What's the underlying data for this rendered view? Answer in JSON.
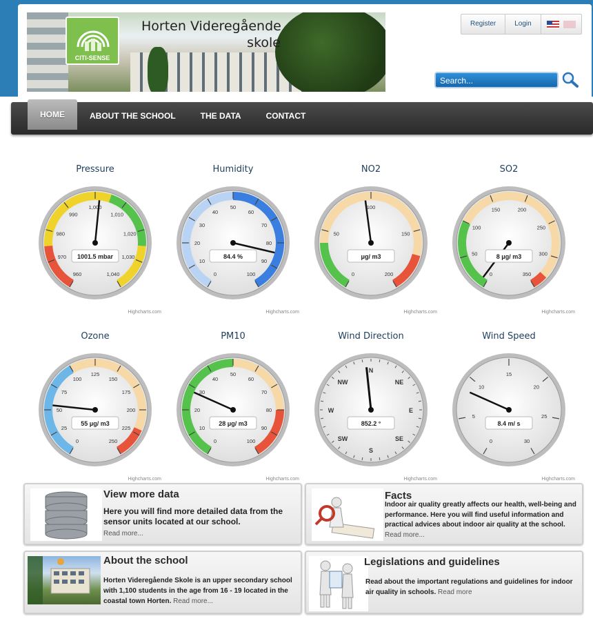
{
  "header": {
    "title_line1": "Horten Videregående",
    "title_line2": "skole",
    "logo_text": "CITI-SENSE",
    "register_label": "Register",
    "login_label": "Login",
    "search_placeholder": "Search...",
    "flags": [
      "flag-us-icon",
      "flag-no-icon"
    ]
  },
  "nav": {
    "items": [
      {
        "label": "HOME",
        "active": true
      },
      {
        "label": "ABOUT THE SCHOOL",
        "active": false
      },
      {
        "label": "THE DATA",
        "active": false
      },
      {
        "label": "CONTACT",
        "active": false
      }
    ]
  },
  "gauges": [
    {
      "title": "Pressure",
      "readout": "1001.5 mbar",
      "value": 1001.5,
      "min": 960,
      "max": 1040,
      "ticks": [
        "960",
        "970",
        "980",
        "990",
        "1,000",
        "1,010",
        "1,020",
        "1,030",
        "1,040"
      ],
      "bands": [
        {
          "from": 960,
          "to": 975,
          "color": "#e8543a"
        },
        {
          "from": 975,
          "to": 990,
          "color": "#f0d32a"
        },
        {
          "from": 990,
          "to": 1005,
          "color": "#f0d32a"
        },
        {
          "from": 1005,
          "to": 1025,
          "color": "#55c24b"
        },
        {
          "from": 1025,
          "to": 1040,
          "color": "#f0d32a"
        }
      ]
    },
    {
      "title": "Humidity",
      "readout": "84.4 %",
      "value": 84.4,
      "min": 0,
      "max": 100,
      "ticks": [
        "0",
        "10",
        "20",
        "30",
        "40",
        "50",
        "60",
        "70",
        "80",
        "90",
        "100"
      ],
      "bands": [
        {
          "from": 0,
          "to": 50,
          "color": "#b9d3f5"
        },
        {
          "from": 50,
          "to": 100,
          "color": "#3a7ee0"
        }
      ]
    },
    {
      "title": "NO2",
      "readout": "μg/ m3",
      "value": 95,
      "min": 0,
      "max": 200,
      "ticks": [
        "0",
        "50",
        "100",
        "150",
        "200"
      ],
      "bands": [
        {
          "from": 0,
          "to": 40,
          "color": "#55c24b"
        },
        {
          "from": 40,
          "to": 170,
          "color": "#f6d9a6"
        },
        {
          "from": 170,
          "to": 200,
          "color": "#e8543a"
        }
      ]
    },
    {
      "title": "SO2",
      "readout": "8 μg/ m3",
      "value": 8,
      "min": 0,
      "max": 350,
      "ticks": [
        "0",
        "50",
        "100",
        "150",
        "200",
        "250",
        "300",
        "350"
      ],
      "bands": [
        {
          "from": 0,
          "to": 100,
          "color": "#55c24b"
        },
        {
          "from": 100,
          "to": 330,
          "color": "#f6d9a6"
        },
        {
          "from": 330,
          "to": 350,
          "color": "#e8543a"
        }
      ]
    },
    {
      "title": "Ozone",
      "readout": "55 μg/ m3",
      "value": 55,
      "min": 0,
      "max": 250,
      "ticks": [
        "0",
        "25",
        "50",
        "75",
        "100",
        "125",
        "150",
        "175",
        "200",
        "225",
        "250"
      ],
      "bands": [
        {
          "from": 0,
          "to": 100,
          "color": "#6cb7e8"
        },
        {
          "from": 100,
          "to": 220,
          "color": "#f6d9a6"
        },
        {
          "from": 220,
          "to": 250,
          "color": "#e8543a"
        }
      ]
    },
    {
      "title": "PM10",
      "readout": "28 μg/ m3",
      "value": 28,
      "min": 0,
      "max": 100,
      "ticks": [
        "0",
        "10",
        "20",
        "30",
        "40",
        "50",
        "60",
        "70",
        "80",
        "90",
        "100"
      ],
      "bands": [
        {
          "from": 0,
          "to": 50,
          "color": "#55c24b"
        },
        {
          "from": 50,
          "to": 80,
          "color": "#f6d9a6"
        },
        {
          "from": 80,
          "to": 100,
          "color": "#e8543a"
        }
      ]
    },
    {
      "title": "Wind Direction",
      "readout": "852.2 °",
      "value": 0,
      "compass": true,
      "labels": [
        "N",
        "NE",
        "E",
        "SE",
        "S",
        "SW",
        "W",
        "NW"
      ]
    },
    {
      "title": "Wind Speed",
      "readout": "8.4 m/ s",
      "value": 8.4,
      "min": 0,
      "max": 30,
      "ticks": [
        "0",
        "5",
        "10",
        "15",
        "20",
        "25",
        "30"
      ],
      "bands": []
    }
  ],
  "credit": "Highcharts.com",
  "boxes": {
    "view_data": {
      "title": "View more data",
      "text": "Here you will find more detailed data from the sensor units located at our school.",
      "more": "Read more..."
    },
    "facts": {
      "title": "Facts",
      "text": "Indoor air quality greatly affects our health, well-being and performance. Here you will find useful information and practical advices about indoor air quality at the school.",
      "more": "Read more..."
    },
    "about": {
      "title": "About the school",
      "text": "Horten Videregående Skole is an upper secondary school with 1,100 students in the age from 16 - 19 located in the coastal town Horten.",
      "more": "Read more..."
    },
    "legislation": {
      "title": "Legislations and guidelines",
      "text": "Read about the important regulations and guidelines for indoor air quality in schools.",
      "more": "Read more"
    }
  }
}
